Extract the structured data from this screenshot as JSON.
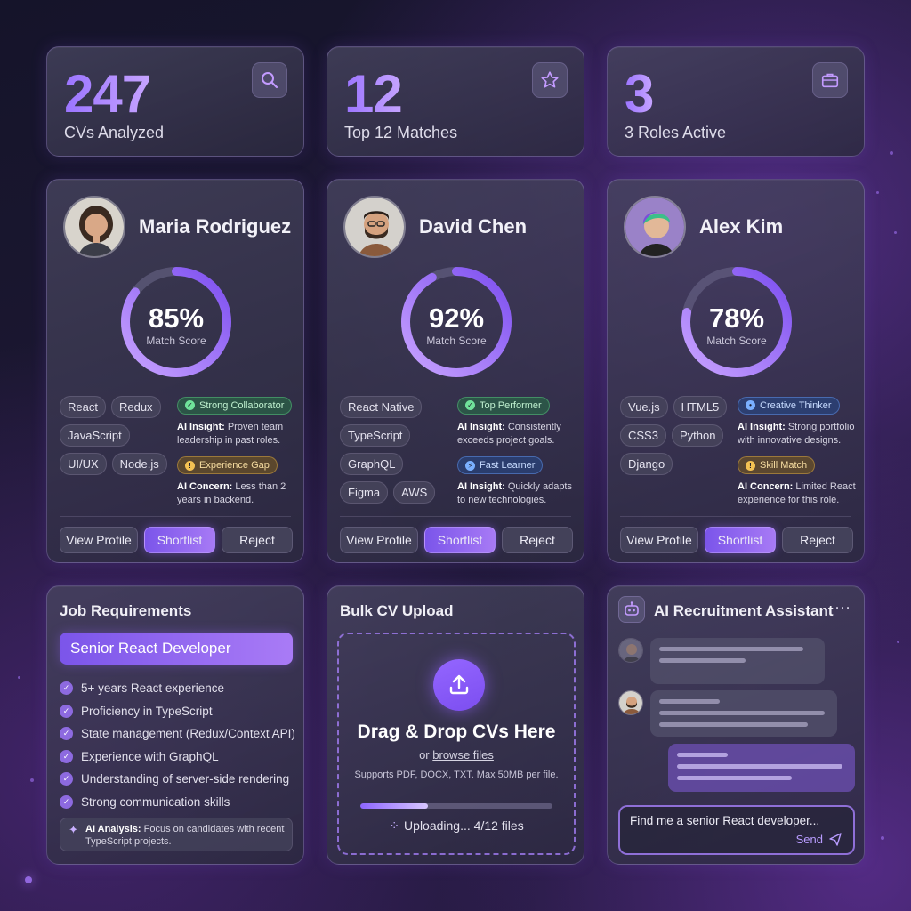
{
  "stats": [
    {
      "value": "247",
      "label": "CVs Analyzed",
      "icon": "search-icon"
    },
    {
      "value": "12",
      "label": "Top 12 Matches",
      "icon": "star-icon"
    },
    {
      "value": "3",
      "label": "3 Roles Active",
      "icon": "briefcase-icon"
    }
  ],
  "candidates": [
    {
      "name": "Maria Rodriguez",
      "score": "85%",
      "score_fraction": 0.85,
      "score_label": "Match Score",
      "skills": [
        "React",
        "Redux",
        "JavaScript",
        "UI/UX",
        "Node.js"
      ],
      "insights": [
        {
          "badge": "Strong Collaborator",
          "tone": "green",
          "prefix": "AI Insight:",
          "text": "Proven team leadership in past roles."
        },
        {
          "badge": "Experience Gap",
          "tone": "amber",
          "prefix": "AI Concern:",
          "text": "Less than 2 years in backend."
        }
      ]
    },
    {
      "name": "David Chen",
      "score": "92%",
      "score_fraction": 0.92,
      "score_label": "Match Score",
      "skills": [
        "React Native",
        "TypeScript",
        "GraphQL",
        "Figma",
        "AWS"
      ],
      "insights": [
        {
          "badge": "Top Performer",
          "tone": "green",
          "prefix": "AI Insight:",
          "text": "Consistently exceeds project goals."
        },
        {
          "badge": "Fast Learner",
          "tone": "blue",
          "prefix": "AI Insight:",
          "text": "Quickly adapts to new technologies."
        }
      ]
    },
    {
      "name": "Alex Kim",
      "score": "78%",
      "score_fraction": 0.78,
      "score_label": "Match Score",
      "skills": [
        "Vue.js",
        "HTML5",
        "CSS3",
        "Python",
        "Django"
      ],
      "insights": [
        {
          "badge": "Creative Thinker",
          "tone": "blue",
          "prefix": "AI Insight:",
          "text": "Strong portfolio with innovative designs."
        },
        {
          "badge": "Skill Match",
          "tone": "amber",
          "prefix": "AI Concern:",
          "text": "Limited React experience for this role."
        }
      ]
    }
  ],
  "actions": {
    "view": "View Profile",
    "shortlist": "Shortlist",
    "reject": "Reject"
  },
  "job": {
    "heading": "Job Requirements",
    "title": "Senior React Developer",
    "requirements": [
      "5+ years React experience",
      "Proficiency in TypeScript",
      "State management (Redux/Context API)",
      "Experience with GraphQL",
      "Understanding of server-side rendering",
      "Strong communication skills"
    ],
    "analysis_prefix": "AI Analysis:",
    "analysis_text": "Focus on candidates with recent TypeScript projects."
  },
  "upload": {
    "heading": "Bulk CV Upload",
    "title": "Drag & Drop CVs Here",
    "or_text": "or",
    "browse_text": "browse files",
    "support": "Supports PDF, DOCX, TXT. Max 50MB per file.",
    "progress_fraction": 0.35,
    "progress_text": "Uploading... 4/12 files"
  },
  "assistant": {
    "heading": "AI Recruitment Assistant",
    "input_value": "Find me a senior React developer...",
    "send_label": "Send"
  },
  "colors": {
    "accent": "#8b5cf6",
    "accent_light": "#b89cff",
    "success": "#6fe39a",
    "warning": "#f4c253",
    "info": "#7ab0ff"
  }
}
